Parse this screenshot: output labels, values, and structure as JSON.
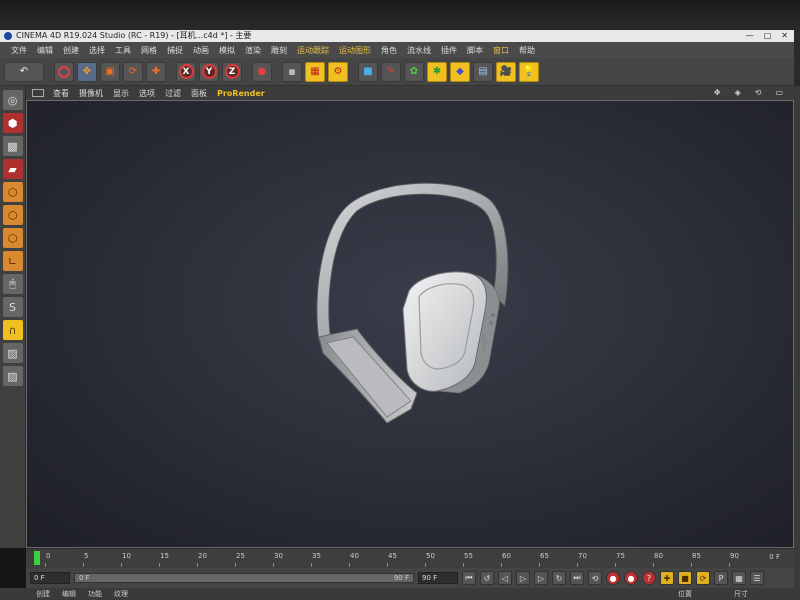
{
  "window": {
    "title": "CINEMA 4D R19.024 Studio (RC - R19) - [耳机...c4d *] - 主要",
    "buttons": [
      "—",
      "□",
      "✕"
    ]
  },
  "menu": {
    "items": [
      "文件",
      "编辑",
      "创建",
      "选择",
      "工具",
      "网格",
      "捕捉",
      "动画",
      "模拟",
      "渲染",
      "雕刻",
      "运动跟踪",
      "运动图形",
      "角色",
      "流水线",
      "插件",
      "脚本",
      "窗口",
      "帮助"
    ]
  },
  "toolbar": {
    "axes": [
      "X",
      "Y",
      "Z"
    ],
    "icons": [
      "undo-icon",
      "live-select-icon",
      "move-icon",
      "scale-icon",
      "rotate-icon",
      "add-icon",
      "axis-x-icon",
      "axis-y-icon",
      "axis-z-icon",
      "coord-system-icon",
      "render-view-icon",
      "render-picture-viewer-icon",
      "edit-render-settings-icon",
      "cube-icon",
      "pen-spline-icon",
      "subdivision-icon",
      "cloner-icon",
      "deformer-icon",
      "floor-icon",
      "camera-icon",
      "light-icon"
    ]
  },
  "viewport": {
    "menu": [
      "查看",
      "摄像机",
      "显示",
      "选项",
      "过滤",
      "面板",
      "ProRender"
    ],
    "highlighted": "ProRender"
  },
  "timeline": {
    "ticks": [
      "0",
      "5",
      "10",
      "15",
      "20",
      "25",
      "30",
      "35",
      "40",
      "45",
      "50",
      "55",
      "60",
      "65",
      "70",
      "75",
      "80",
      "85",
      "90"
    ],
    "current_frame": "0 F"
  },
  "transport": {
    "start_field": "0 F",
    "range_start": "0 F",
    "range_end": "90 F",
    "end_field": "90 F"
  },
  "bottom": {
    "tabs": [
      "创建",
      "编辑",
      "功能",
      "纹理"
    ],
    "labels": [
      "位置",
      "尺寸"
    ]
  },
  "colors": {
    "accent": "#f0c020",
    "axis_red": "#e03a3a",
    "playhead": "#3fd03f"
  }
}
